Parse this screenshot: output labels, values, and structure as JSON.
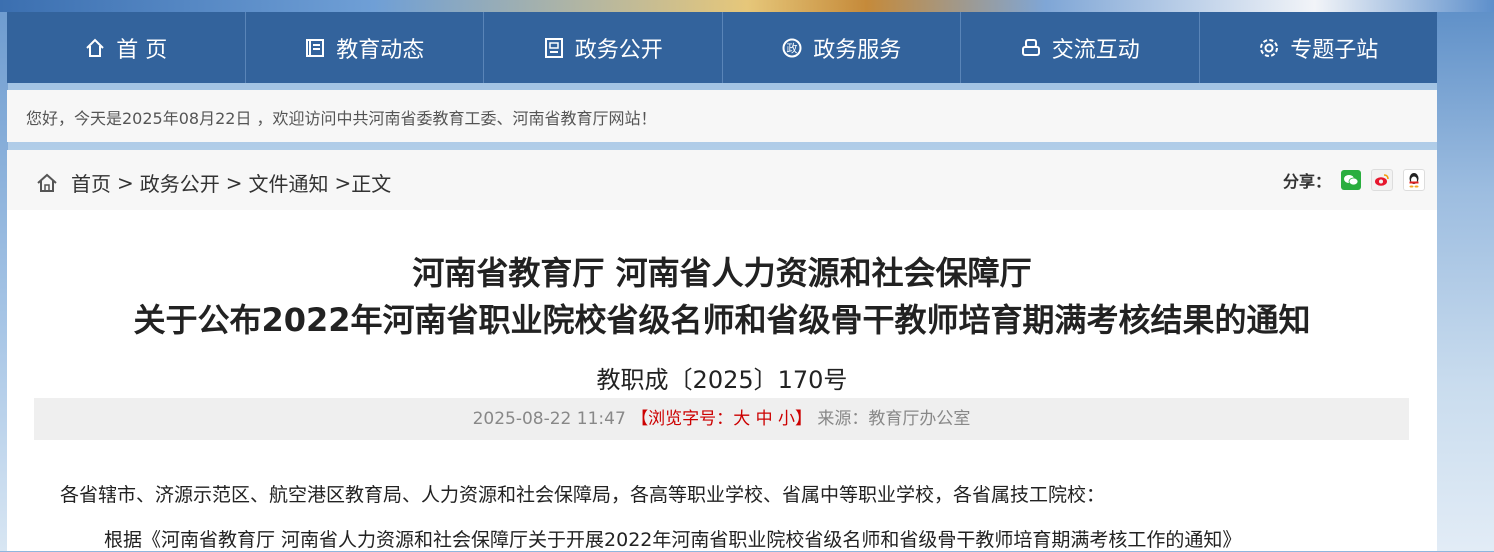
{
  "nav": {
    "items": [
      {
        "label": "首 页",
        "icon": "home-icon"
      },
      {
        "label": "教育动态",
        "icon": "news-icon"
      },
      {
        "label": "政务公开",
        "icon": "document-icon"
      },
      {
        "label": "政务服务",
        "icon": "service-icon"
      },
      {
        "label": "交流互动",
        "icon": "interaction-icon"
      },
      {
        "label": "专题子站",
        "icon": "settings-icon"
      }
    ]
  },
  "welcome": {
    "text": "您好，今天是2025年08月22日 ，欢迎访问中共河南省委教育工委、河南省教育厅网站！"
  },
  "breadcrumb": {
    "home": "首页",
    "level1": "政务公开",
    "level2": "文件通知",
    "current": "正文",
    "sep": ">"
  },
  "share": {
    "label": "分享："
  },
  "article": {
    "title_line1": "河南省教育厅 河南省人力资源和社会保障厅",
    "title_line2": "关于公布2022年河南省职业院校省级名师和省级骨干教师培育期满考核结果的通知",
    "doc_number": "教职成〔2025〕170号",
    "date": "2025-08-22 11:47",
    "font_size_label": "【浏览字号：",
    "size_large": "大",
    "size_medium": "中",
    "size_small": "小",
    "font_size_close": "】",
    "source": "来源：教育厅办公室",
    "para1": "各省辖市、济源示范区、航空港区教育局、人力资源和社会保障局，各高等职业学校、省属中等职业学校，各省属技工院校：",
    "para2": "根据《河南省教育厅 河南省人力资源和社会保障厅关于开展2022年河南省职业院校省级名师和省级骨干教师培育期满考核工作的通知》"
  },
  "colors": {
    "nav_bg": "#33639c",
    "accent_red": "#cc0000"
  }
}
